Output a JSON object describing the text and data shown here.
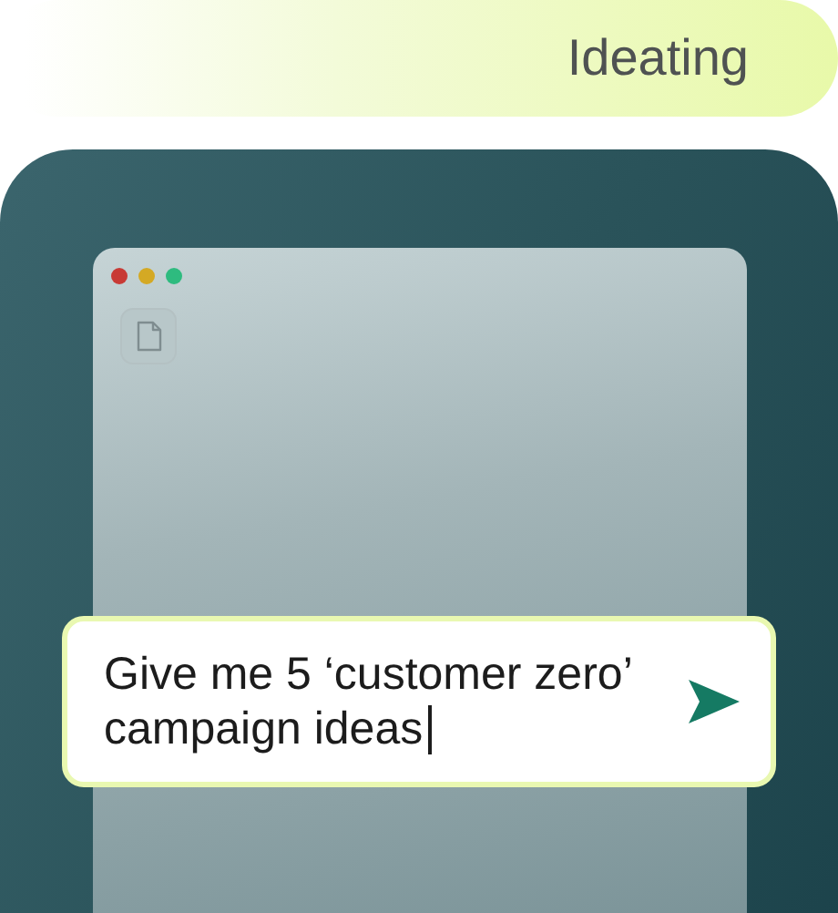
{
  "header": {
    "label": "Ideating"
  },
  "window": {
    "prompt": {
      "value": "Give me 5 ‘customer zero’ campaign ideas",
      "cursor": true
    }
  }
}
